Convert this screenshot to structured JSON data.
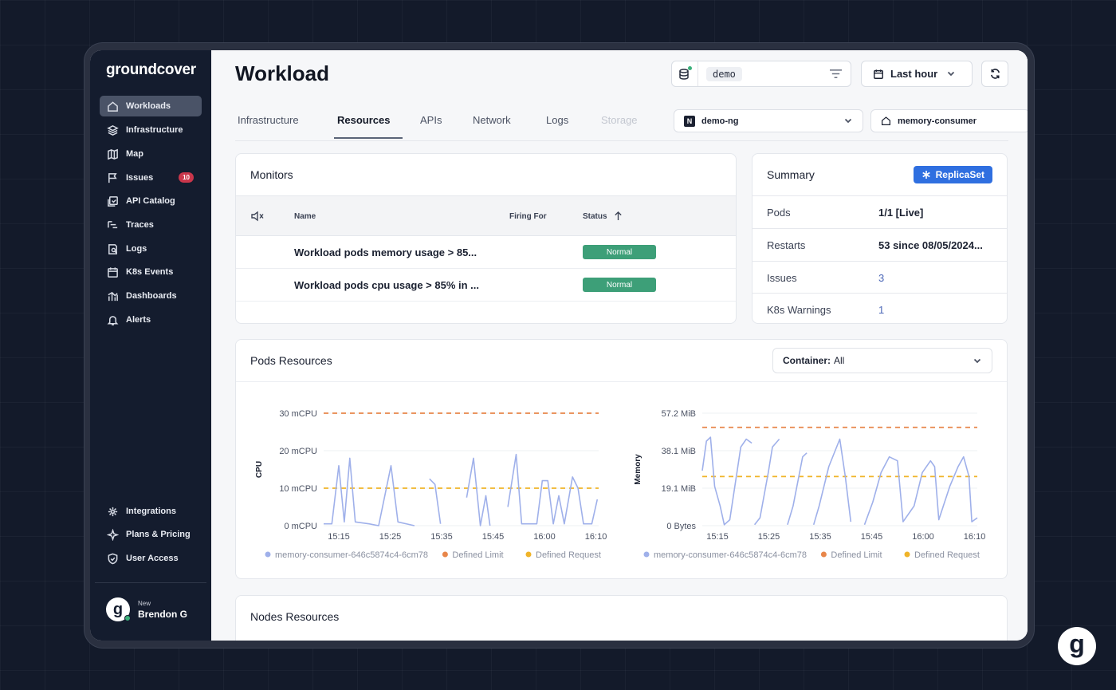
{
  "app": {
    "logo": "groundcover",
    "page_title": "Workload"
  },
  "sidebar": {
    "items": [
      {
        "label": "Workloads",
        "icon": "home-icon",
        "active": true
      },
      {
        "label": "Infrastructure",
        "icon": "layers-icon"
      },
      {
        "label": "Map",
        "icon": "map-icon"
      },
      {
        "label": "Issues",
        "icon": "flag-icon",
        "badge": "10"
      },
      {
        "label": "API Catalog",
        "icon": "api-catalog-icon"
      },
      {
        "label": "Traces",
        "icon": "traces-icon"
      },
      {
        "label": "Logs",
        "icon": "logs-icon"
      },
      {
        "label": "K8s Events",
        "icon": "calendar-icon"
      },
      {
        "label": "Dashboards",
        "icon": "dashboards-icon"
      },
      {
        "label": "Alerts",
        "icon": "bell-icon"
      }
    ],
    "bottom_items": [
      {
        "label": "Integrations",
        "icon": "integrations-icon"
      },
      {
        "label": "Plans & Pricing",
        "icon": "sparkle-icon"
      },
      {
        "label": "User Access",
        "icon": "shield-icon"
      }
    ],
    "user": {
      "avatar_letter": "g",
      "tag": "New",
      "name": "Brendon G"
    }
  },
  "header": {
    "env": "demo",
    "time_range": "Last hour"
  },
  "tabs": [
    {
      "label": "Infrastructure"
    },
    {
      "label": "Resources",
      "active": true
    },
    {
      "label": "APIs"
    },
    {
      "label": "Network"
    },
    {
      "label": "Logs"
    },
    {
      "label": "Storage",
      "disabled": true
    }
  ],
  "selectors": {
    "namespace_badge": "N",
    "namespace": "demo-ng",
    "workload": "memory-consumer"
  },
  "monitors": {
    "title": "Monitors",
    "columns": {
      "name": "Name",
      "firing_for": "Firing For",
      "status": "Status"
    },
    "rows": [
      {
        "name": "Workload pods memory usage > 85...",
        "firing_for": "",
        "status": "Normal"
      },
      {
        "name": "Workload pods cpu usage > 85% in ...",
        "firing_for": "",
        "status": "Normal"
      }
    ]
  },
  "summary": {
    "title": "Summary",
    "kind": "ReplicaSet",
    "rows": [
      {
        "key": "Pods",
        "value": "1/1 [Live]"
      },
      {
        "key": "Restarts",
        "value": "53 since 08/05/2024..."
      },
      {
        "key": "Issues",
        "value": "3"
      },
      {
        "key": "K8s Warnings",
        "value": "1"
      }
    ]
  },
  "pods_resources": {
    "title": "Pods Resources",
    "container_label": "Container:",
    "container_value": "All"
  },
  "nodes_resources": {
    "title": "Nodes Resources"
  },
  "colors": {
    "series": "#9fb0ea",
    "limit": "#e8864a",
    "request": "#f0b429",
    "status_normal": "#3d9f78",
    "accent": "#2f6fe0"
  },
  "chart_data": [
    {
      "type": "line",
      "ylabel": "CPU",
      "yticks": [
        "0 mCPU",
        "10 mCPU",
        "20 mCPU",
        "30 mCPU"
      ],
      "ylim": [
        0,
        30
      ],
      "xticks": [
        "15:15",
        "15:25",
        "15:35",
        "15:45",
        "16:00",
        "16:10"
      ],
      "legend": [
        "memory-consumer-646c5874c4-6cm78",
        "Defined Limit",
        "Defined Request"
      ],
      "limit": 30,
      "request": 10,
      "series": [
        {
          "name": "memory-consumer-646c5874c4-6cm78",
          "segments": [
            [
              [
                0,
                0.5
              ],
              [
                0.03,
                0.5
              ],
              [
                0.055,
                16
              ],
              [
                0.075,
                1
              ],
              [
                0.095,
                18
              ],
              [
                0.115,
                1
              ],
              [
                0.165,
                0.5
              ],
              [
                0.2,
                0
              ],
              [
                0.245,
                16
              ],
              [
                0.27,
                1
              ],
              [
                0.33,
                0
              ]
            ],
            [
              [
                0.385,
                12.5
              ],
              [
                0.405,
                11
              ],
              [
                0.425,
                0.5
              ]
            ],
            [
              [
                0.52,
                7.5
              ],
              [
                0.545,
                18
              ],
              [
                0.57,
                0
              ],
              [
                0.59,
                8
              ],
              [
                0.605,
                0
              ]
            ],
            [
              [
                0.67,
                5
              ],
              [
                0.7,
                19
              ],
              [
                0.72,
                0.5
              ],
              [
                0.775,
                0.5
              ],
              [
                0.795,
                12
              ],
              [
                0.815,
                12
              ],
              [
                0.835,
                0.5
              ],
              [
                0.855,
                8
              ],
              [
                0.875,
                0.5
              ],
              [
                0.905,
                13
              ],
              [
                0.925,
                10
              ],
              [
                0.945,
                0.5
              ],
              [
                0.975,
                0.5
              ],
              [
                0.995,
                7
              ]
            ]
          ]
        },
        {
          "name": "Defined Limit",
          "value": 30
        },
        {
          "name": "Defined Request",
          "value": 10
        }
      ]
    },
    {
      "type": "line",
      "ylabel": "Memory",
      "yticks": [
        "0 Bytes",
        "19.1 MiB",
        "38.1 MiB",
        "57.2 MiB"
      ],
      "ylim": [
        0,
        57.2
      ],
      "xticks": [
        "15:15",
        "15:25",
        "15:35",
        "15:45",
        "16:00",
        "16:10"
      ],
      "legend": [
        "memory-consumer-646c5874c4-6cm78",
        "Defined Limit",
        "Defined Request"
      ],
      "limit": 50,
      "request": 25,
      "series": [
        {
          "name": "memory-consumer-646c5874c4-6cm78",
          "segments": [
            [
              [
                0,
                28
              ],
              [
                0.015,
                43
              ],
              [
                0.03,
                45
              ],
              [
                0.045,
                20
              ],
              [
                0.065,
                10
              ],
              [
                0.08,
                0.5
              ],
              [
                0.1,
                3
              ],
              [
                0.14,
                40
              ],
              [
                0.16,
                44
              ],
              [
                0.18,
                42
              ]
            ],
            [
              [
                0.19,
                0.5
              ],
              [
                0.21,
                4
              ],
              [
                0.24,
                27
              ],
              [
                0.255,
                40
              ],
              [
                0.28,
                44
              ]
            ],
            [
              [
                0.31,
                0.5
              ],
              [
                0.33,
                10
              ],
              [
                0.365,
                35
              ],
              [
                0.38,
                37
              ]
            ],
            [
              [
                0.405,
                0.5
              ],
              [
                0.425,
                10
              ],
              [
                0.46,
                30
              ],
              [
                0.5,
                44
              ],
              [
                0.52,
                25
              ],
              [
                0.54,
                2
              ]
            ],
            [
              [
                0.59,
                0.5
              ],
              [
                0.62,
                12
              ],
              [
                0.65,
                27
              ],
              [
                0.68,
                35
              ],
              [
                0.71,
                33
              ],
              [
                0.73,
                2
              ],
              [
                0.77,
                10
              ],
              [
                0.8,
                27
              ],
              [
                0.83,
                33
              ],
              [
                0.845,
                30
              ],
              [
                0.86,
                3
              ],
              [
                0.9,
                20
              ],
              [
                0.93,
                30
              ],
              [
                0.95,
                35
              ],
              [
                0.97,
                25
              ],
              [
                0.98,
                2
              ],
              [
                1.0,
                4
              ]
            ]
          ]
        },
        {
          "name": "Defined Limit",
          "value": 50
        },
        {
          "name": "Defined Request",
          "value": 25
        }
      ]
    }
  ],
  "floating": {
    "logo_letter": "g"
  }
}
